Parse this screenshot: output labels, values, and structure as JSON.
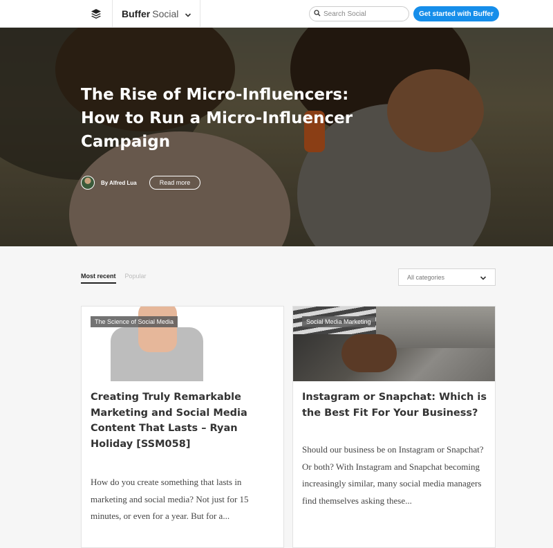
{
  "header": {
    "brand_name": "Buffer",
    "brand_suffix": "Social",
    "search_placeholder": "Search Social",
    "cta_label": "Get started with Buffer"
  },
  "hero": {
    "title": "The Rise of Micro-Influencers: How to Run a Micro-Influencer Campaign",
    "author": "By Alfred Lua",
    "read_more_label": "Read more"
  },
  "filters": {
    "tabs": [
      "Most recent",
      "Popular"
    ],
    "category_select": "All categories"
  },
  "cards": [
    {
      "tag": "The Science of Social Media",
      "title": "Creating Truly Remarkable Marketing and Social Media Content That Lasts – Ryan Holiday [SSM058]",
      "excerpt": "How do you create something that lasts in marketing and social media? Not just for 15 minutes, or even for a year. But for a..."
    },
    {
      "tag": "Social Media Marketing",
      "title": "Instagram or Snapchat: Which is the Best Fit For Your Business?",
      "excerpt": "Should our business be on Instagram or Snapchat? Or both? With Instagram and Snapchat becoming increasingly similar, many social media managers find themselves asking these..."
    }
  ],
  "colors": {
    "accent": "#168eea"
  },
  "icons": [
    "buffer-logo-icon",
    "chevron-down-icon",
    "search-icon"
  ]
}
